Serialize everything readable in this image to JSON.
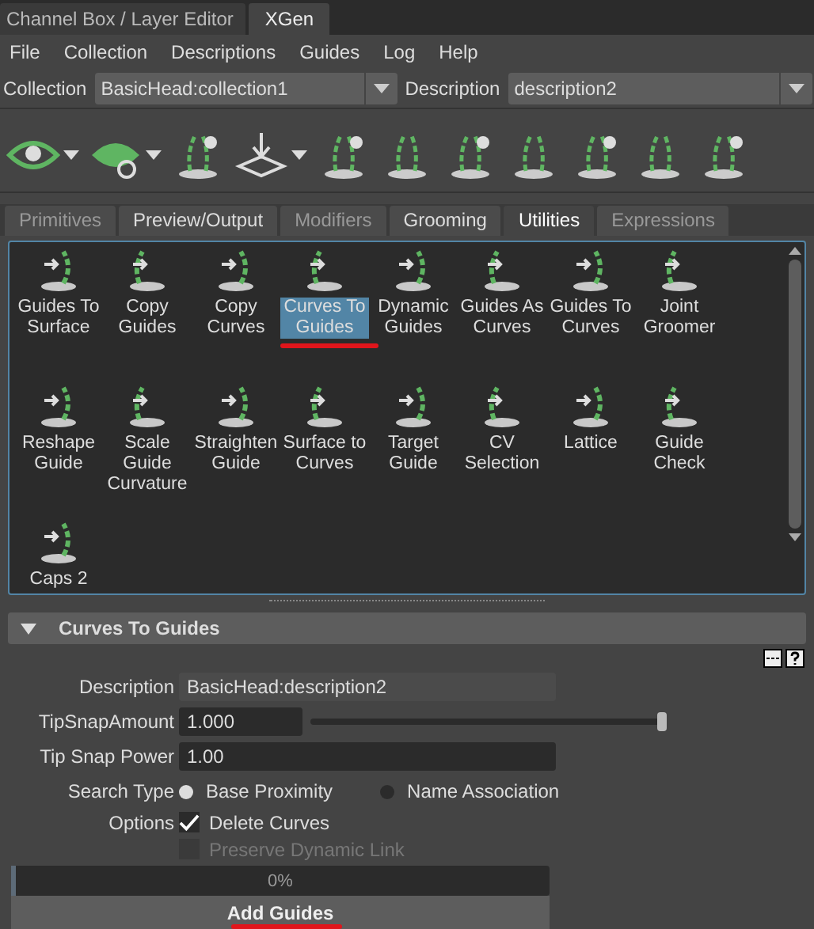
{
  "top_tabs": [
    {
      "label": "Channel Box / Layer Editor",
      "selected": false
    },
    {
      "label": "XGen",
      "selected": true
    }
  ],
  "menu": [
    "File",
    "Collection",
    "Descriptions",
    "Guides",
    "Log",
    "Help"
  ],
  "collection": {
    "label": "Collection",
    "value": "BasicHead:collection1"
  },
  "description": {
    "label": "Description",
    "value": "description2"
  },
  "tabs": [
    {
      "label": "Primitives",
      "selected": false,
      "disabled": true
    },
    {
      "label": "Preview/Output",
      "selected": false,
      "disabled": false
    },
    {
      "label": "Modifiers",
      "selected": false,
      "disabled": true
    },
    {
      "label": "Grooming",
      "selected": false,
      "disabled": false
    },
    {
      "label": "Utilities",
      "selected": true,
      "disabled": false
    },
    {
      "label": "Expressions",
      "selected": false,
      "disabled": true
    }
  ],
  "tools": [
    {
      "label": "Guides To Surface",
      "selected": false,
      "underlined": false
    },
    {
      "label": "Copy Guides",
      "selected": false,
      "underlined": false
    },
    {
      "label": "Copy Curves",
      "selected": false,
      "underlined": false
    },
    {
      "label": "Curves To Guides",
      "selected": true,
      "underlined": true
    },
    {
      "label": "Dynamic Guides",
      "selected": false,
      "underlined": false
    },
    {
      "label": "Guides As Curves",
      "selected": false,
      "underlined": false
    },
    {
      "label": "Guides To Curves",
      "selected": false,
      "underlined": false
    },
    {
      "label": "Joint Groomer",
      "selected": false,
      "underlined": false
    },
    {
      "label": "Reshape Guide",
      "selected": false,
      "underlined": false
    },
    {
      "label": "Scale Guide Curvature",
      "selected": false,
      "underlined": false
    },
    {
      "label": "Straighten Guide",
      "selected": false,
      "underlined": false
    },
    {
      "label": "Surface to Curves",
      "selected": false,
      "underlined": false
    },
    {
      "label": "Target Guide",
      "selected": false,
      "underlined": false
    },
    {
      "label": "CV Selection",
      "selected": false,
      "underlined": false
    },
    {
      "label": "Lattice",
      "selected": false,
      "underlined": false
    },
    {
      "label": "Guide Check",
      "selected": false,
      "underlined": false
    },
    {
      "label": "Caps 2",
      "selected": false,
      "underlined": false
    }
  ],
  "section": {
    "title": "Curves To Guides",
    "expanded": true
  },
  "form": {
    "description": {
      "label": "Description",
      "value": "BasicHead:description2"
    },
    "tip_snap_amount": {
      "label": "TipSnapAmount",
      "value": "1.000",
      "level": 1
    },
    "tip_snap_power": {
      "label": "Tip Snap Power",
      "value": "1.00"
    },
    "search_type": {
      "label": "Search Type",
      "options": [
        {
          "label": "Base Proximity",
          "selected": true
        },
        {
          "label": "Name Association",
          "selected": false
        }
      ]
    },
    "options": {
      "label": "Options",
      "items": [
        {
          "label": "Delete Curves",
          "checked": true,
          "disabled": false
        },
        {
          "label": "Preserve Dynamic Link",
          "checked": false,
          "disabled": true
        }
      ]
    },
    "progress": {
      "label": "0%",
      "level": 0
    },
    "button": {
      "label": "Add Guides",
      "underlined": true
    }
  }
}
